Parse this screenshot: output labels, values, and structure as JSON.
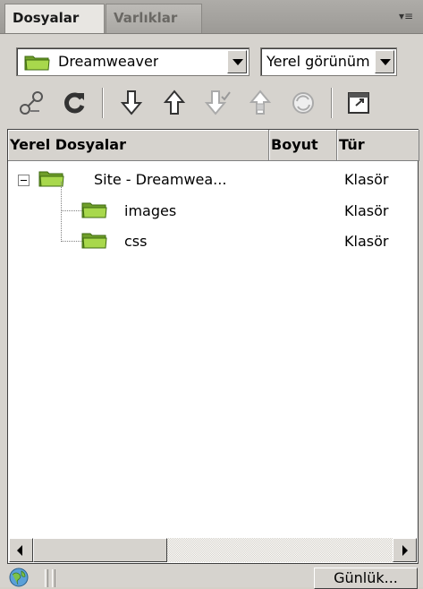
{
  "tabs": [
    {
      "label": "Dosyalar",
      "active": true
    },
    {
      "label": "Varlıklar",
      "active": false
    }
  ],
  "panel_menu_icon": "panel-options-icon",
  "site_select": {
    "value": "Dreamweaver",
    "icon": "folder-icon"
  },
  "view_select": {
    "value": "Yerel görünüm"
  },
  "toolbar": {
    "icons": [
      "connect-icon",
      "refresh-icon",
      "get-files-icon",
      "put-files-icon",
      "check-out-icon",
      "check-in-icon",
      "synchronize-icon",
      "expand-icon"
    ]
  },
  "columns": {
    "name": "Yerel Dosyalar",
    "size": "Boyut",
    "type": "Tür"
  },
  "rows": [
    {
      "name": "Site - Dreamwea...",
      "type": "Klasör"
    },
    {
      "name": "images",
      "type": "Klasör"
    },
    {
      "name": "css",
      "type": "Klasör"
    }
  ],
  "status": {
    "log_button": "Günlük...",
    "status_icon": "globe-icon"
  },
  "colors": {
    "panel_bg": "#d6d3ce",
    "folder_green": "#8bc63f",
    "list_bg": "#ffffff"
  }
}
